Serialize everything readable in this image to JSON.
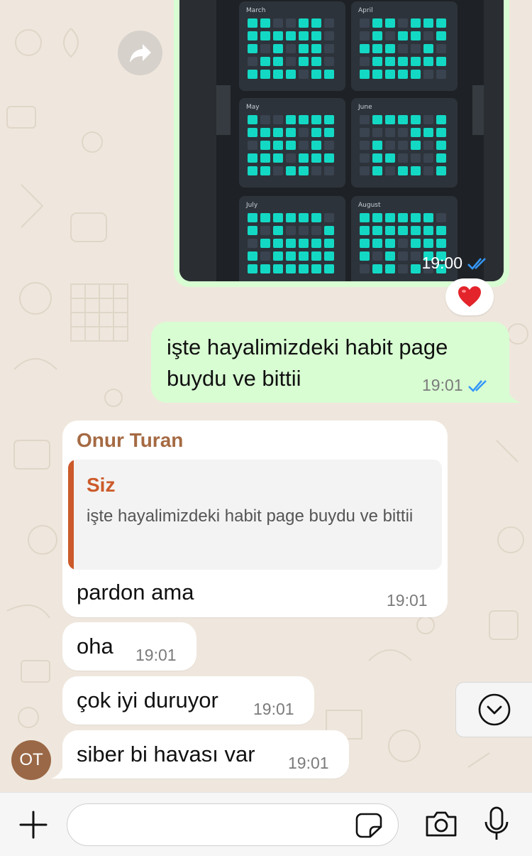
{
  "chat": {
    "image_message": {
      "time": "19:00",
      "months": [
        "March",
        "April",
        "May",
        "June",
        "July",
        "August"
      ]
    },
    "reaction": "❤️",
    "outgoing_text": {
      "text": "işte hayalimizdeki habit page buydu ve bittii",
      "time": "19:01"
    },
    "reply_message": {
      "sender": "Onur Turan",
      "quoted_author": "Siz",
      "quoted_text": "işte hayalimizdeki habit page buydu ve bittii",
      "text": "pardon ama",
      "time": "19:01"
    },
    "incoming_messages": [
      {
        "text": "oha",
        "time": "19:01"
      },
      {
        "text": "çok iyi duruyor",
        "time": "19:01"
      },
      {
        "text": "siber bi havası var",
        "time": "19:01"
      }
    ],
    "avatar_initials": "OT"
  },
  "colors": {
    "outgoing_bubble": "#d8fdd2",
    "incoming_bubble": "#ffffff",
    "read_ticks": "#3497f9",
    "sender_name": "#a56a43",
    "quote_accent": "#cc5a2a",
    "habit_cell_on": "#13d8c4",
    "habit_cell_off": "#3a4350"
  },
  "icons": {
    "forward": "forward-arrow-icon",
    "heart": "heart-emoji",
    "scroll": "chevron-down-icon",
    "attach": "plus-icon",
    "sticker": "sticker-icon",
    "camera": "camera-icon",
    "mic": "microphone-icon"
  }
}
